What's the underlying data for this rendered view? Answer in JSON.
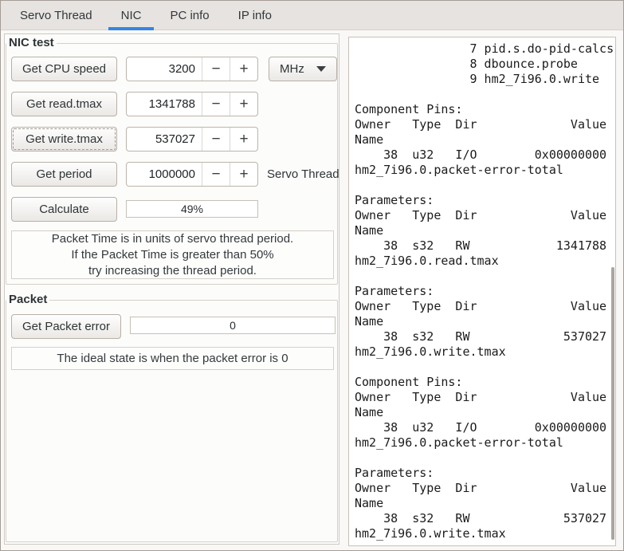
{
  "tabs": {
    "servo_thread": "Servo Thread",
    "nic": "NIC",
    "pc_info": "PC info",
    "ip_info": "IP info"
  },
  "nic_test": {
    "legend": "NIC test",
    "rows": [
      {
        "button": "Get CPU speed",
        "value": "3200"
      },
      {
        "button": "Get read.tmax",
        "value": "1341788"
      },
      {
        "button": "Get write.tmax",
        "value": "537027"
      },
      {
        "button": "Get period",
        "value": "1000000"
      }
    ],
    "combo_label": "MHz",
    "servo_thread_label": "Servo Thread",
    "calculate_button": "Calculate",
    "progress_value": "49%",
    "info_line1": "Packet Time is in units of servo thread period.",
    "info_line2": "If the Packet Time is greater than 50%",
    "info_line3": "try increasing the thread period."
  },
  "packet": {
    "legend": "Packet",
    "button": "Get Packet error",
    "error_value": "0",
    "info": "The ideal state is when the packet error is 0"
  },
  "spin": {
    "minus": "−",
    "plus": "+"
  },
  "hal_output": {
    "text": "                7 pid.s.do-pid-calcs\n                8 dbounce.probe\n                9 hm2_7i96.0.write\n\nComponent Pins:\nOwner   Type  Dir             Value\nName\n    38  u32   I/O        0x00000000\nhm2_7i96.0.packet-error-total\n\nParameters:\nOwner   Type  Dir             Value\nName\n    38  s32   RW            1341788\nhm2_7i96.0.read.tmax\n\nParameters:\nOwner   Type  Dir             Value\nName\n    38  s32   RW             537027\nhm2_7i96.0.write.tmax\n\nComponent Pins:\nOwner   Type  Dir             Value\nName\n    38  u32   I/O        0x00000000\nhm2_7i96.0.packet-error-total\n\nParameters:\nOwner   Type  Dir             Value\nName\n    38  s32   RW             537027\nhm2_7i96.0.write.tmax"
  },
  "colors": {
    "accent": "#3584e4"
  }
}
